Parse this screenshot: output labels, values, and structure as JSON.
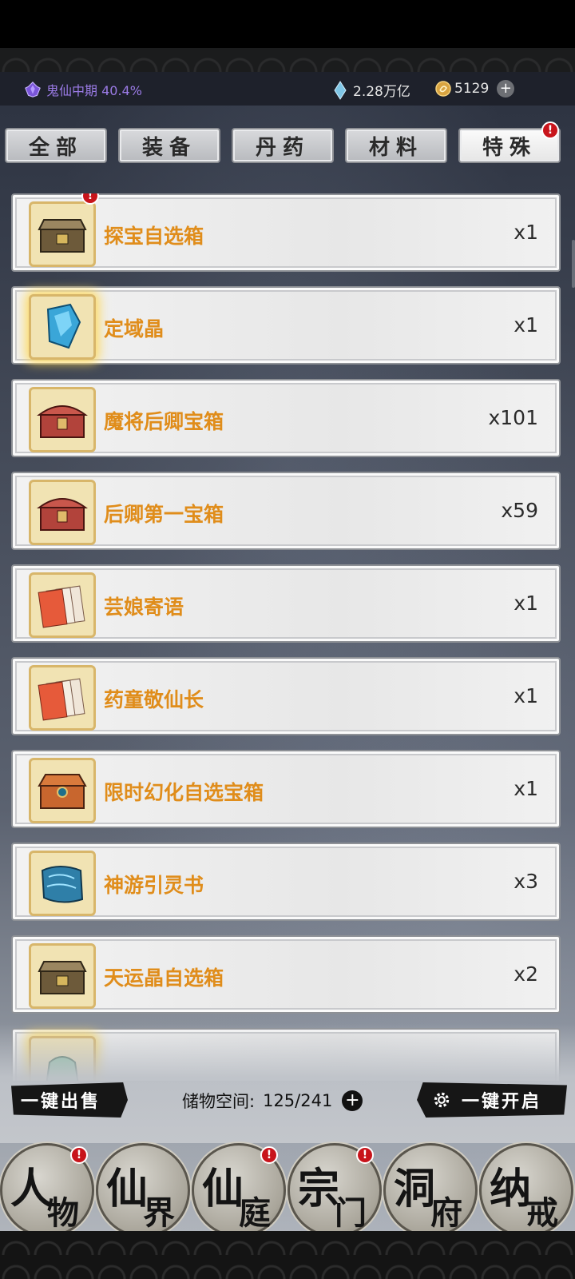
{
  "status": {
    "realm_label": "鬼仙中期 40.4%",
    "spirit_stone": "2.28万亿",
    "coins": "5129"
  },
  "tabs": [
    {
      "label": "全部"
    },
    {
      "label": "装备"
    },
    {
      "label": "丹药"
    },
    {
      "label": "材料"
    },
    {
      "label": "特殊"
    }
  ],
  "active_tab": "特殊",
  "badge_symbol": "!",
  "items": [
    {
      "name": "探宝自选箱",
      "qty": "x1",
      "icon": "treasure-chest-icon",
      "badge": true
    },
    {
      "name": "定域晶",
      "qty": "x1",
      "icon": "blue-crystal-icon",
      "badge": false
    },
    {
      "name": "魔将后卿宝箱",
      "qty": "x101",
      "icon": "red-chest-icon",
      "badge": false
    },
    {
      "name": "后卿第一宝箱",
      "qty": "x59",
      "icon": "red-chest-icon",
      "badge": false
    },
    {
      "name": "芸娘寄语",
      "qty": "x1",
      "icon": "letter-cards-icon",
      "badge": false
    },
    {
      "name": "药童敬仙长",
      "qty": "x1",
      "icon": "letter-cards-icon",
      "badge": false
    },
    {
      "name": "限时幻化自选宝箱",
      "qty": "x1",
      "icon": "orange-chest-icon",
      "badge": false
    },
    {
      "name": "神游引灵书",
      "qty": "x3",
      "icon": "scroll-icon",
      "badge": false
    },
    {
      "name": "天运晶自选箱",
      "qty": "x2",
      "icon": "treasure-chest-icon",
      "badge": false
    }
  ],
  "bottom_bar": {
    "sell_all": "一键出售",
    "storage_label": "储物空间:",
    "storage_value": "125/241",
    "open_all": "一键开启"
  },
  "nav": [
    {
      "big": "人",
      "small": "物",
      "badge": true
    },
    {
      "big": "仙",
      "small": "界",
      "badge": false
    },
    {
      "big": "仙",
      "small": "庭",
      "badge": true
    },
    {
      "big": "宗",
      "small": "门",
      "badge": true
    },
    {
      "big": "洞",
      "small": "府",
      "badge": false
    },
    {
      "big": "纳",
      "small": "戒",
      "badge": false
    }
  ],
  "colors": {
    "item_name": "#e08d1b",
    "realm": "#9b7be6",
    "badge": "#c8141b"
  }
}
